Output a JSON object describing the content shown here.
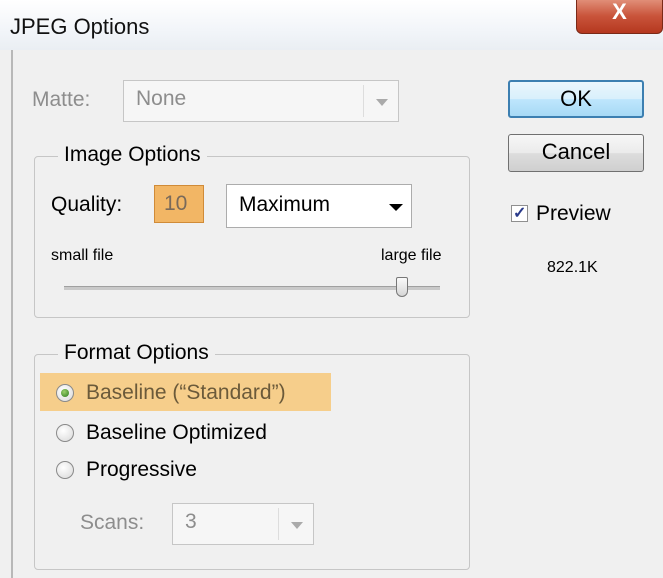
{
  "window": {
    "title": "JPEG Options",
    "close_label": "X"
  },
  "matte": {
    "label": "Matte:",
    "value": "None"
  },
  "image_options": {
    "legend": "Image Options",
    "quality_label": "Quality:",
    "quality_value": "10",
    "quality_preset": "Maximum",
    "small_label": "small file",
    "large_label": "large file",
    "slider_level": 0.9
  },
  "format_options": {
    "legend": "Format Options",
    "baseline": "Baseline (“Standard”)",
    "baseline_optimized": "Baseline Optimized",
    "progressive": "Progressive",
    "scans_label": "Scans:",
    "scans_value": "3"
  },
  "buttons": {
    "ok": "OK",
    "cancel": "Cancel"
  },
  "preview": {
    "label": "Preview",
    "checked": true,
    "size": "822.1K"
  },
  "colors": {
    "highlight": "#f8c36a",
    "ok_border": "#3c7fb1"
  }
}
